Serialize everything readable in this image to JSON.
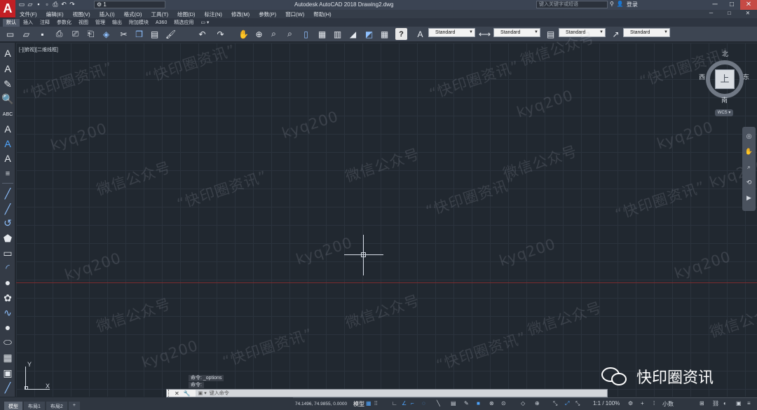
{
  "titlebar": {
    "logo_letter": "A",
    "workspace": "⚙ 1",
    "window_title": "Autodesk AutoCAD 2018    Drawing2.dwg",
    "search_placeholder": "键入关键字或短语",
    "login": "登录",
    "window_buttons": [
      "─",
      "□",
      "✕"
    ]
  },
  "menubar": {
    "items": [
      "文件(F)",
      "编辑(E)",
      "视图(V)",
      "插入(I)",
      "格式(O)",
      "工具(T)",
      "绘图(D)",
      "标注(N)",
      "修改(M)",
      "参数(P)",
      "窗口(W)",
      "帮助(H)"
    ],
    "right": [
      "─",
      "□",
      "✕"
    ]
  },
  "ribbon": {
    "tabs": [
      "默认",
      "插入",
      "注释",
      "参数化",
      "视图",
      "管理",
      "输出",
      "附加模块",
      "A360",
      "精选应用",
      "▭ ▾"
    ],
    "active_index": 0
  },
  "toolbar": {
    "icons": [
      "new-icon",
      "open-icon",
      "save-icon",
      "print-icon",
      "plot-preview-icon",
      "publish-icon",
      "3d-print-icon",
      "cut-icon",
      "copy-icon",
      "paste-icon",
      "match-properties-icon",
      "undo-icon",
      "redo-icon",
      "pan-icon",
      "zoom-realtime-icon",
      "zoom-window-icon",
      "zoom-previous-icon",
      "properties-icon",
      "design-center-icon",
      "tool-palettes-icon",
      "sheet-set-icon",
      "markup-icon",
      "quickcalc-icon",
      "help-icon",
      "text-style-icon",
      "dim-style-icon",
      "table-style-icon",
      "multileader-style-icon"
    ],
    "text_style": "Standard",
    "dim_style": "Standard",
    "table_style": "Standard",
    "mleader_style": "Standard"
  },
  "palette": {
    "tools": [
      "A",
      "A",
      "✎",
      "🔍",
      "ABC",
      "A",
      "A",
      "A",
      "≡",
      "╱",
      "╱",
      "↺",
      "⬟",
      "▭",
      "◜",
      "●",
      "✿",
      "∿",
      "●",
      "⬭",
      "▦",
      "▣",
      "╱"
    ]
  },
  "drawing": {
    "viewport_label": "[-][俯视][二维线框]",
    "watermark_cn": "“快印圈资讯”",
    "watermark_cn2": "微信公众号",
    "watermark_en": "kyq200"
  },
  "viewcube": {
    "face": "上",
    "north": "北",
    "south": "南",
    "east": "东",
    "west": "西",
    "wcs": "WCS ▾"
  },
  "ucs": {
    "x_label": "X",
    "y_label": "Y"
  },
  "command": {
    "history": [
      "命令: _options",
      "命令:"
    ],
    "prompt": "键入命令",
    "buttons": [
      "✕",
      "🔧",
      "▣ ▾"
    ]
  },
  "layout_tabs": {
    "items": [
      "模型",
      "布局1",
      "布局2",
      "+"
    ],
    "active_index": 0
  },
  "statusbar": {
    "coords": "74.1496, 74.9855, 0.0000",
    "model": "模型",
    "scale": "1:1 / 100%",
    "units": "小数",
    "accent_color": "#4fa6ff"
  },
  "wechat_badge": {
    "label": "快印圈资讯"
  },
  "colors": {
    "canvas": "#212830",
    "grid": "#2b333d",
    "x_axis": "#7a2b2f",
    "crosshair": "#d7dde6",
    "close_button": "#c64a45",
    "logo_red": "#c21f24"
  }
}
